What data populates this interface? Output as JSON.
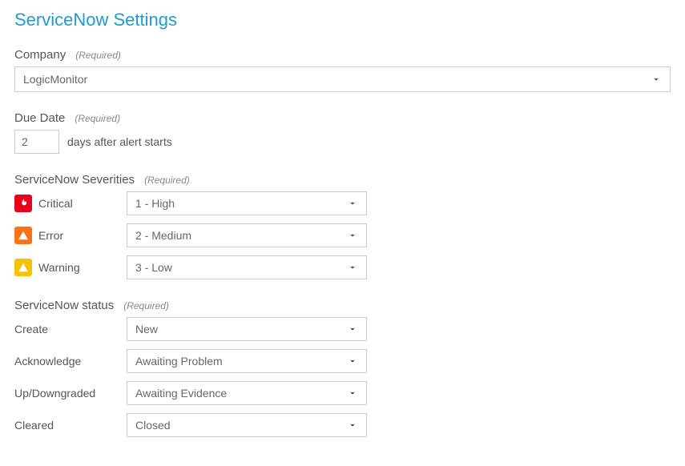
{
  "title": "ServiceNow Settings",
  "required_text": "(Required)",
  "company": {
    "label": "Company",
    "value": "LogicMonitor"
  },
  "due_date": {
    "label": "Due Date",
    "value": "2",
    "suffix": "days after alert starts"
  },
  "severities": {
    "label": "ServiceNow Severities",
    "rows": [
      {
        "name": "Critical",
        "value": "1 - High"
      },
      {
        "name": "Error",
        "value": "2 - Medium"
      },
      {
        "name": "Warning",
        "value": "3 - Low"
      }
    ]
  },
  "status": {
    "label": "ServiceNow status",
    "rows": [
      {
        "name": "Create",
        "value": "New"
      },
      {
        "name": "Acknowledge",
        "value": "Awaiting Problem"
      },
      {
        "name": "Up/Downgraded",
        "value": "Awaiting Evidence"
      },
      {
        "name": "Cleared",
        "value": "Closed"
      }
    ]
  }
}
